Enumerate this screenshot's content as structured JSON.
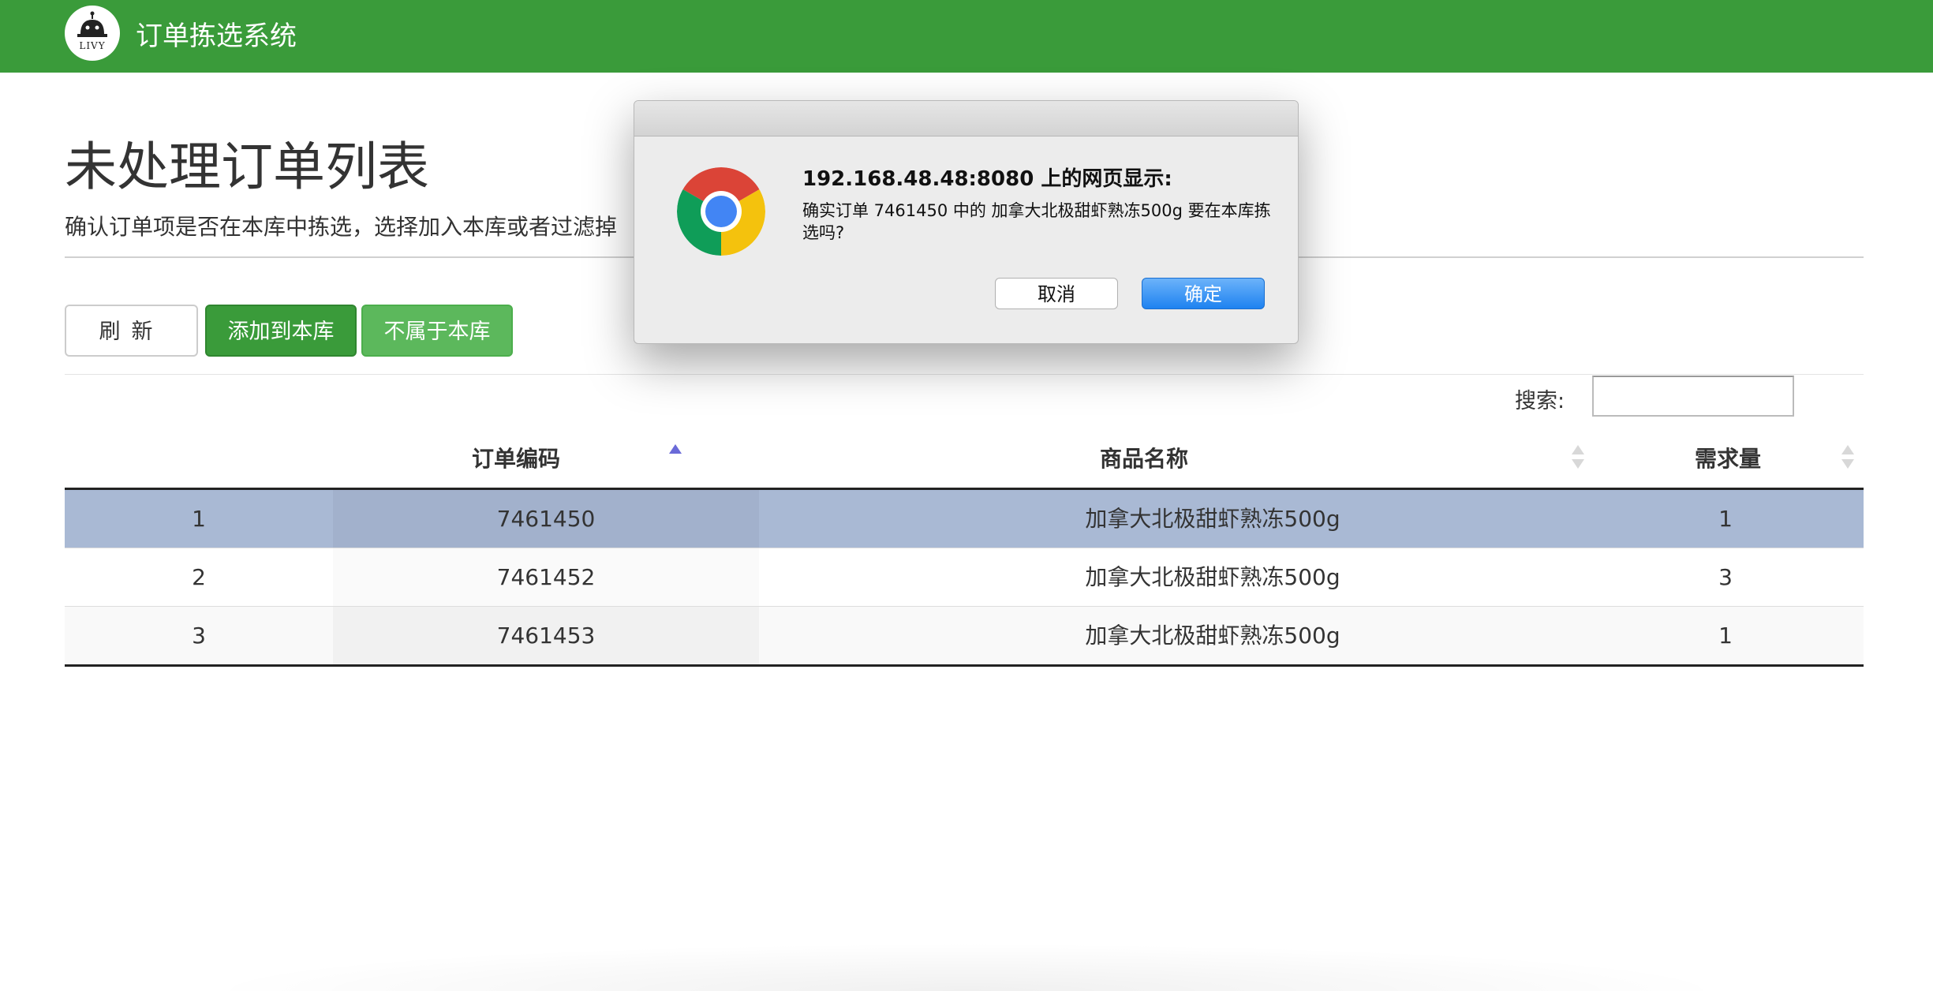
{
  "navbar": {
    "logo_text": "LIVY",
    "app_title": "订单拣选系统"
  },
  "header": {
    "title": "未处理订单列表",
    "subtitle": "确认订单项是否在本库中拣选，选择加入本库或者过滤掉"
  },
  "toolbar": {
    "refresh_label": "刷新",
    "add_label": "添加到本库",
    "not_ours_label": "不属于本库"
  },
  "search": {
    "label": "搜索:",
    "value": ""
  },
  "table": {
    "columns": [
      "",
      "订单编码",
      "商品名称",
      "需求量"
    ],
    "sorted_column": "订单编码",
    "rows": [
      {
        "index": "1",
        "order_code": "7461450",
        "product": "加拿大北极甜虾熟冻500g",
        "qty": "1",
        "selected": true
      },
      {
        "index": "2",
        "order_code": "7461452",
        "product": "加拿大北极甜虾熟冻500g",
        "qty": "3",
        "selected": false
      },
      {
        "index": "3",
        "order_code": "7461453",
        "product": "加拿大北极甜虾熟冻500g",
        "qty": "1",
        "selected": false
      }
    ]
  },
  "dialog": {
    "title": "192.168.48.48:8080 上的网页显示:",
    "message": "确实订单 7461450 中的 加拿大北极甜虾熟冻500g 要在本库拣选吗?",
    "cancel_label": "取消",
    "ok_label": "确定",
    "icon": "chrome-icon"
  },
  "colors": {
    "navbar": "#3a9b3a",
    "primary_button": "#3a9b3a",
    "secondary_button": "#5cb85c",
    "selected_row": "#a9b9d4",
    "dialog_ok": "#1e82f0"
  }
}
